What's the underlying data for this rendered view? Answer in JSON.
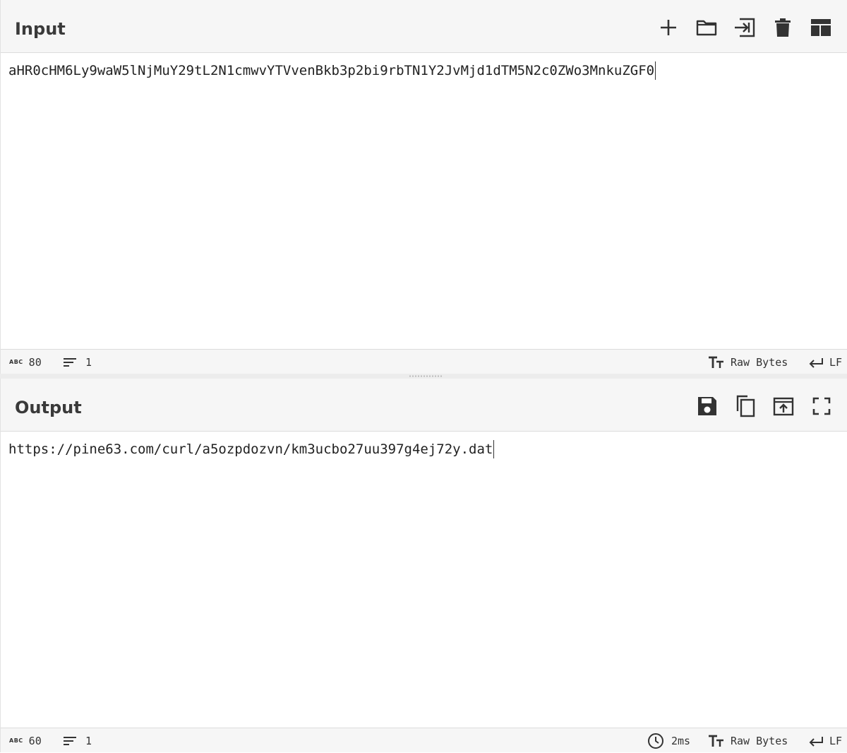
{
  "input": {
    "title": "Input",
    "content": "aHR0cHM6Ly9waW5lNjMuY29tL2N1cmwvYTVvenBkb3p2bi9rbTN1Y2JvMjd1dTM5N2c0ZWo3MnkuZGF0",
    "toolbar": [
      "plus-icon",
      "folder-icon",
      "insert-icon",
      "trash-icon",
      "layout-icon"
    ],
    "status": {
      "length": "80",
      "lines": "1",
      "encoding": "Raw Bytes",
      "eol": "LF"
    }
  },
  "output": {
    "title": "Output",
    "content": "https://pine63.com/curl/a5ozpdozvn/km3ucbo27uu397g4ej72y.dat",
    "toolbar": [
      "save-icon",
      "copy-icon",
      "replace-input-icon",
      "fullscreen-icon"
    ],
    "status": {
      "length": "60",
      "lines": "1",
      "time": "2ms",
      "encoding": "Raw Bytes",
      "eol": "LF"
    }
  },
  "colors": {
    "header_bg": "#f6f6f6",
    "border": "#dcdcdc",
    "text": "#333333"
  }
}
